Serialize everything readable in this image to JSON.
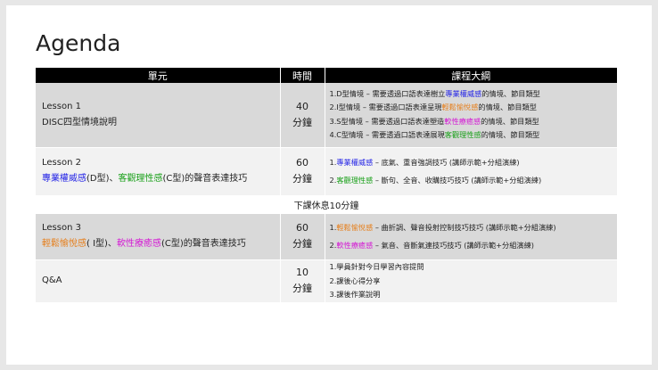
{
  "title": "Agenda",
  "headers": {
    "unit": "單元",
    "time": "時間",
    "outline": "課程大綱"
  },
  "colors": {
    "blue": "#2323e6",
    "green": "#1aa01a",
    "orange": "#e67e1a",
    "magenta": "#d41ad4"
  },
  "rows": [
    {
      "unit_line1": "Lesson 1",
      "unit_line2": "DISC四型情境說明",
      "time_num": "40",
      "time_unit": "分鐘",
      "outline": [
        {
          "pre": "1.D型情境 – 需要透過口語表達樹立",
          "hl": "專業權威感",
          "post": "的情境、節目類型"
        },
        {
          "pre": "2.I型情境 – 需要透過口語表達呈現",
          "hl": "輕鬆愉悅感",
          "post": "的情境、節目類型"
        },
        {
          "pre": "3.S型情境 – 需要透過口語表達塑造",
          "hl": "軟性療癒感",
          "post": "的情境、節目類型"
        },
        {
          "pre": "4.C型情境 – 需要透過口語表達展現",
          "hl": "客觀理性感",
          "post": "的情境、節目類型"
        }
      ]
    },
    {
      "unit_line1": "Lesson 2",
      "unit_a": "專業權威感",
      "unit_b": "(D型)、",
      "unit_c": "客觀理性感",
      "unit_d": "(C型)的聲音表達技巧",
      "time_num": "60",
      "time_unit": "分鐘",
      "outline": [
        {
          "pre": "1.",
          "hl": "專業權威感",
          "post": " – 底氣、重音強調技巧 (講師示範+分組演練)"
        },
        {
          "pre": "2.",
          "hl": "客觀理性感",
          "post": " – 斷句、全音、收購技巧技巧 (講師示範+分組演練)"
        }
      ]
    },
    {
      "break": "下課休息10分鐘"
    },
    {
      "unit_line1": "Lesson 3",
      "unit_a": "輕鬆愉悅感",
      "unit_b": "( I型)、",
      "unit_c": "軟性療癒感",
      "unit_d": "(C型)的聲音表達技巧",
      "time_num": "60",
      "time_unit": "分鐘",
      "outline": [
        {
          "pre": "1.",
          "hl": "輕鬆愉悅感",
          "post": " – 曲折調、聲音投射控制技巧技巧 (講師示範+分組演練)"
        },
        {
          "pre": "2.",
          "hl": "軟性療癒感",
          "post": " – 氣音、音斷氣連技巧技巧 (講師示範+分組演練)"
        }
      ]
    },
    {
      "unit_line1": "Q&A",
      "time_num": "10",
      "time_unit": "分鐘",
      "outline": [
        {
          "text": "1.學員針對今日學習內容提問"
        },
        {
          "text": "2.課後心得分享"
        },
        {
          "text": "3.課後作業說明"
        }
      ]
    }
  ]
}
